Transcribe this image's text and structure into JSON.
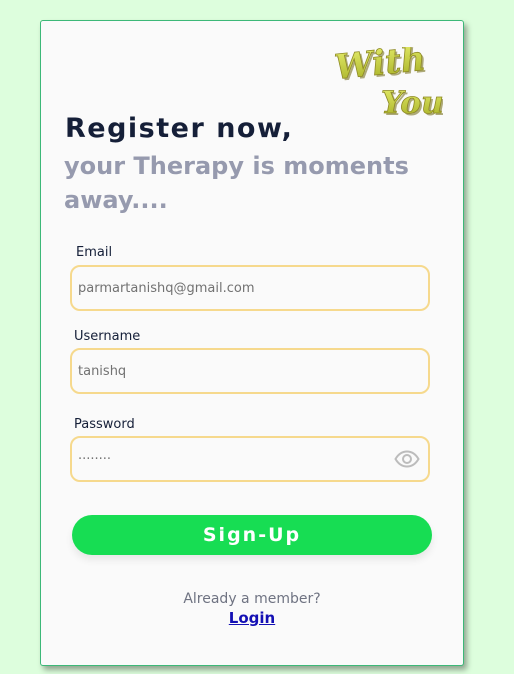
{
  "logo": {
    "line1": "With",
    "line2": "You"
  },
  "heading": {
    "title": "Register now,",
    "subtitle": "your Therapy is moments away...."
  },
  "form": {
    "email": {
      "label": "Email",
      "value": "parmartanishq@gmail.com"
    },
    "username": {
      "label": "Username",
      "value": "tanishq"
    },
    "password": {
      "label": "Password",
      "value": "········",
      "icon": "eye-icon"
    },
    "submit_label": "Sign-Up"
  },
  "footer": {
    "member_text": "Already a member?",
    "login_label": "Login"
  },
  "colors": {
    "background": "#ddfedd",
    "card": "#fafafa",
    "title": "#151f38",
    "subtitle": "#969aae",
    "field_border": "#f6d98d",
    "button": "#17dd53",
    "link": "#1410b4",
    "logo": "#c8d04a"
  }
}
